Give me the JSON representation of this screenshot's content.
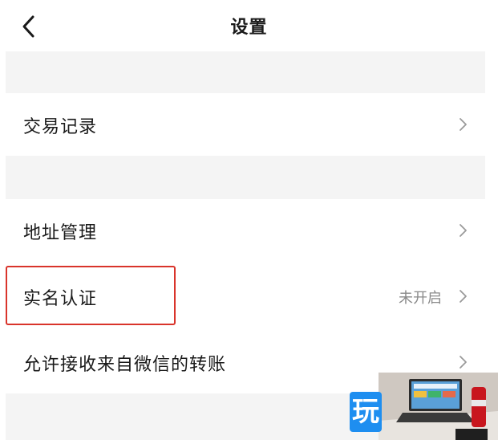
{
  "header": {
    "title": "设置",
    "back_icon": "chevron-left-icon"
  },
  "rows": [
    {
      "label": "交易记录",
      "value": ""
    },
    {
      "label": "地址管理",
      "value": ""
    },
    {
      "label": "实名认证",
      "value": "未开启"
    },
    {
      "label": "允许接收来自微信的转账",
      "value": ""
    }
  ],
  "overlay": {
    "logo_text": "玩"
  },
  "colors": {
    "section_gap": "#f4f4f4",
    "highlight_border": "#d9342b",
    "value_text": "#8a8a8a",
    "chevron": "#9a9a9a"
  }
}
